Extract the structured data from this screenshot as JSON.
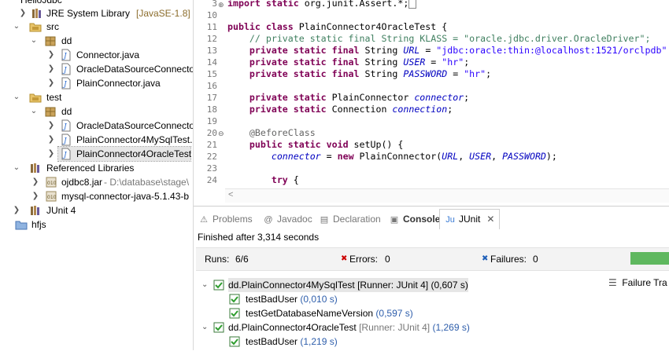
{
  "explorer": {
    "project_partial": "HelloJdbc",
    "jre": {
      "label": "JRE System Library",
      "decor": "[JavaSE-1.8]"
    },
    "src": "src",
    "src_pkg": "dd",
    "src_files": [
      "Connector.java",
      "OracleDataSourceConnecto",
      "PlainConnector.java"
    ],
    "test": "test",
    "test_pkg": "dd",
    "test_files": [
      "OracleDataSourceConnecto",
      "PlainConnector4MySqlTest.",
      "PlainConnector4OracleTest"
    ],
    "reflibs": "Referenced Libraries",
    "jar1": {
      "label": "ojdbc8.jar",
      "decor": " - D:\\database\\stage\\"
    },
    "jar2": {
      "label": "mysql-connector-java-5.1.43-b"
    },
    "junit": "JUnit 4",
    "hfjs": "hfjs"
  },
  "editor": {
    "line_numbers": [
      "3",
      "10",
      "11",
      "12",
      "13",
      "14",
      "15",
      "16",
      "17",
      "18",
      "19",
      "20",
      "21",
      "22",
      "23",
      "24"
    ],
    "lines": {
      "l3_kw": "import static ",
      "l3_rest": "org.junit.Assert.*;",
      "l11_kw1": "public class ",
      "l11_rest": "PlainConnector4OracleTest {",
      "l12": "    // private static final String KLASS = \"oracle.jdbc.driver.OracleDriver\";",
      "l13_kw": "    private static final ",
      "l13_type": "String ",
      "l13_f": "URL",
      "l13_eq": " = ",
      "l13_s": "\"jdbc:oracle:thin:@localhost:1521/orclpdb\"",
      "l14_kw": "    private static final ",
      "l14_type": "String ",
      "l14_f": "USER",
      "l14_eq": " = ",
      "l14_s": "\"hr\"",
      "l14_end": ";",
      "l15_kw": "    private static final ",
      "l15_type": "String ",
      "l15_f": "PASSWORD",
      "l15_eq": " = ",
      "l15_s": "\"hr\"",
      "l15_end": ";",
      "l17_kw": "    private static ",
      "l17_type": "PlainConnector ",
      "l17_f": "connector",
      "l17_end": ";",
      "l18_kw": "    private static ",
      "l18_type": "Connection ",
      "l18_f": "connection",
      "l18_end": ";",
      "l20_an": "    @BeforeClass",
      "l21_kw": "    public static void ",
      "l21_rest": "setUp() {",
      "l22_a": "        ",
      "l22_f": "connector",
      "l22_b": " = ",
      "l22_kw": "new ",
      "l22_c": "PlainConnector(",
      "l22_f1": "URL",
      "l22_d": ", ",
      "l22_f2": "USER",
      "l22_e": ", ",
      "l22_f3": "PASSWORD",
      "l22_g": ");",
      "l24_kw": "        try",
      "l24_rest": " {"
    },
    "scroll_left": "<"
  },
  "views": {
    "tabs": [
      "Problems",
      "Javadoc",
      "Declaration",
      "Console",
      "JUnit"
    ],
    "tab_close": "✕",
    "finished": "Finished after 3,314 seconds",
    "runs_label": "Runs:",
    "runs_value": "6/6",
    "errors_label": "Errors:",
    "errors_value": "0",
    "failures_label": "Failures:",
    "failures_value": "0",
    "failure_trace": "Failure Tra",
    "results": [
      {
        "name": "dd.PlainConnector4MySqlTest [Runner: JUnit 4] (0,607 s)"
      },
      {
        "name": "testBadUser",
        "time": " (0,010 s)"
      },
      {
        "name": "testGetDatabaseNameVersion",
        "time": " (0,597 s)"
      },
      {
        "name": "dd.PlainConnector4OracleTest",
        "meta": " [Runner: JUnit 4]",
        "time": " (1,269 s)"
      },
      {
        "name": "testBadUser",
        "time": " (1,219 s)"
      }
    ],
    "progress_fraction": 1.0,
    "colors": {
      "progress": "#5fb85f",
      "keyword": "#7f0055",
      "string": "#2a00ff",
      "comment": "#3f7f5f",
      "field": "#0000c0"
    }
  }
}
